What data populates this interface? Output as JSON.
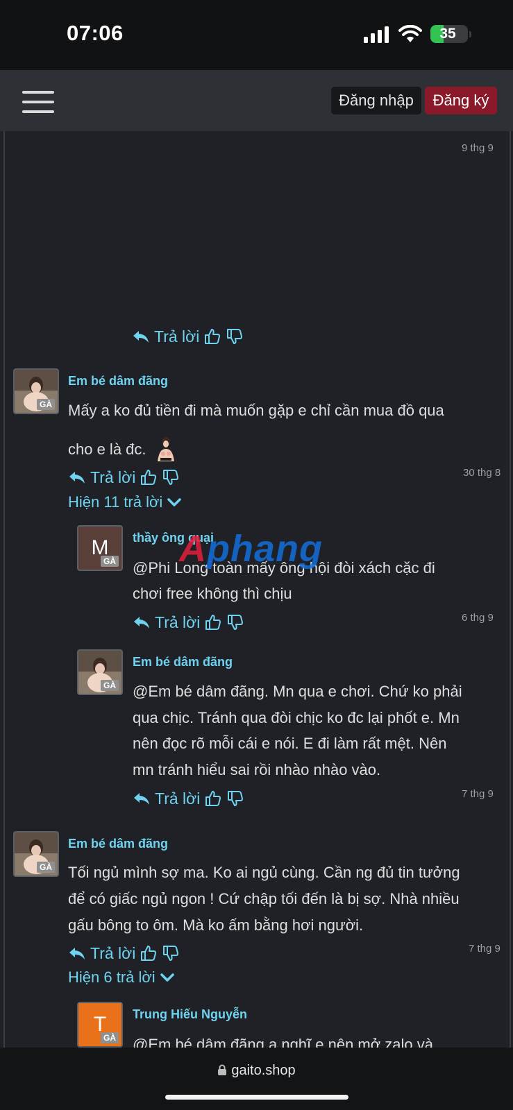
{
  "status_bar": {
    "time": "07:06",
    "battery": "35",
    "battery_level": 0.35
  },
  "navbar": {
    "login_label": "Đăng nhập",
    "register_label": "Đăng ký"
  },
  "comments": [
    {
      "date": "9 thg 9",
      "reply_label": "Trả lời"
    },
    {
      "author": "Em bé dâm đãng",
      "text_line1": "Mấy a ko đủ tiền đi mà muốn gặp e chỉ cần mua đồ qua",
      "text_line2": "cho e là đc.",
      "date": "30 thg 8",
      "reply_label": "Trả lời",
      "show_replies": "Hiện 11 trả lời",
      "badge": "GÀ",
      "replies": [
        {
          "author": "thầy ông quại",
          "avatar_letter": "M",
          "badge": "GÀ",
          "text_line1": "@Phi Long toàn mấy ông hội đòi xách cặc đi",
          "text_line2": "chơi free không thì chịu",
          "date": "6 thg 9",
          "reply_label": "Trả lời"
        },
        {
          "author": "Em bé dâm đãng",
          "badge": "GÀ",
          "text_line1": "@Em bé dâm đãng. Mn qua e chơi. Chứ ko phải",
          "text_line2": "qua chịc. Tránh qua đòi chịc ko đc lại phốt e. Mn",
          "text_line3": "nên đọc rõ mỗi cái e nói. E đi làm rất mệt. Nên",
          "text_line4": "mn tránh hiểu sai rồi nhào nhào vào.",
          "date": "7 thg 9",
          "reply_label": "Trả lời"
        }
      ]
    },
    {
      "author": "Em bé dâm đãng",
      "badge": "GÀ",
      "text_line1": "Tối ngủ mình sợ ma. Ko ai ngủ cùng. Cần ng đủ tin tưởng",
      "text_line2": "để có giấc ngủ ngon ! Cứ chập tối đến là bị sợ. Nhà nhiều",
      "text_line3": "gấu bông to ôm. Mà ko ấm bằng hơi người.",
      "date": "7 thg 9",
      "reply_label": "Trả lời",
      "show_replies": "Hiện 6 trả lời",
      "replies": [
        {
          "author": "Trung Hiếu Nguyễn",
          "avatar_letter": "T",
          "badge": "GÀ",
          "text_line1": "@Em bé dâm đãng a nghĩ e nên mở zalo và"
        }
      ]
    }
  ],
  "watermark": {
    "part1": "A",
    "part2": "phang"
  },
  "browser": {
    "url": "gaito.shop"
  },
  "colors": {
    "accent": "#6fd3f0",
    "register": "#8a1a2a",
    "background": "#1f2126"
  }
}
